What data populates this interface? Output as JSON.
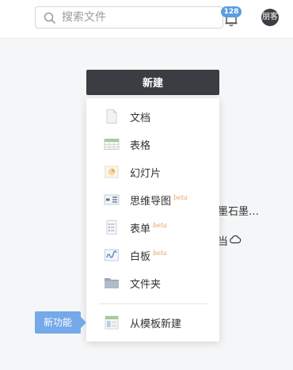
{
  "header": {
    "search_placeholder": "搜索文件",
    "notification_count": "128",
    "avatar_text": "朋客"
  },
  "background": {
    "file_name_fragment": "墨石墨…",
    "file_icon_fragment": "当"
  },
  "new_button_label": "新建",
  "menu": {
    "items": [
      {
        "label": "文档",
        "beta": ""
      },
      {
        "label": "表格",
        "beta": ""
      },
      {
        "label": "幻灯片",
        "beta": ""
      },
      {
        "label": "思维导图",
        "beta": "beta"
      },
      {
        "label": "表单",
        "beta": "beta"
      },
      {
        "label": "白板",
        "beta": "beta"
      },
      {
        "label": "文件夹",
        "beta": ""
      },
      {
        "label": "从模板新建",
        "beta": ""
      }
    ]
  },
  "new_feature_tag": "新功能",
  "colors": {
    "badge": "#5b9de0",
    "new_button": "#3a3d42",
    "beta": "#e6a35a",
    "tag": "#74a9ea"
  }
}
